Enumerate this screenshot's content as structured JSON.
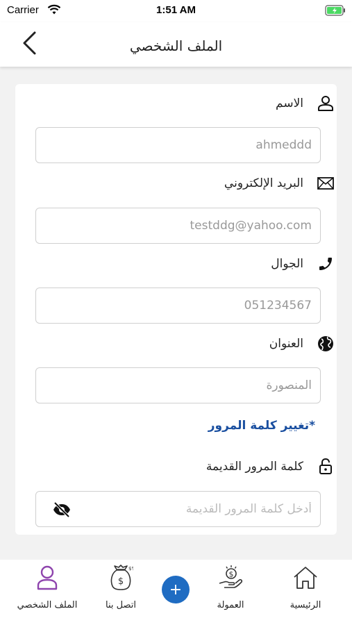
{
  "status_bar": {
    "carrier": "Carrier",
    "time": "1:51 AM"
  },
  "header": {
    "title": "الملف الشخصي",
    "back_icon": "chevron-left-icon"
  },
  "form": {
    "name": {
      "label": "الاسم",
      "icon": "user-icon",
      "value": "ahmeddd"
    },
    "email": {
      "label": "البريد الإلكتروني",
      "icon": "envelope-icon",
      "value": "testddg@yahoo.com"
    },
    "mobile": {
      "label": "الجوال",
      "icon": "phone-icon",
      "value": "051234567"
    },
    "address": {
      "label": "العنوان",
      "icon": "globe-icon",
      "value": "المنصورة"
    },
    "change_password_link": "*تغيير كلمة المرور",
    "old_password": {
      "label": "كلمة المرور  القديمة",
      "icon": "lock-icon",
      "placeholder": "أدخل كلمة المرور القديمة"
    }
  },
  "tab_bar": {
    "accent": "#8e44ad",
    "items": [
      {
        "label": "الملف الشخصي",
        "icon": "user-icon",
        "active": true
      },
      {
        "label": "اتصل بنا",
        "icon": "money-bag-icon",
        "active": false
      },
      {
        "label": "+",
        "icon": "plus-icon",
        "active": false
      },
      {
        "label": "العمولة",
        "icon": "hand-coin-icon",
        "active": false
      },
      {
        "label": "الرئيسية",
        "icon": "home-icon",
        "active": false
      }
    ]
  },
  "colors": {
    "link": "#1a4fa0",
    "add_button": "#1f6cc2",
    "background": "#f2f2f2"
  }
}
